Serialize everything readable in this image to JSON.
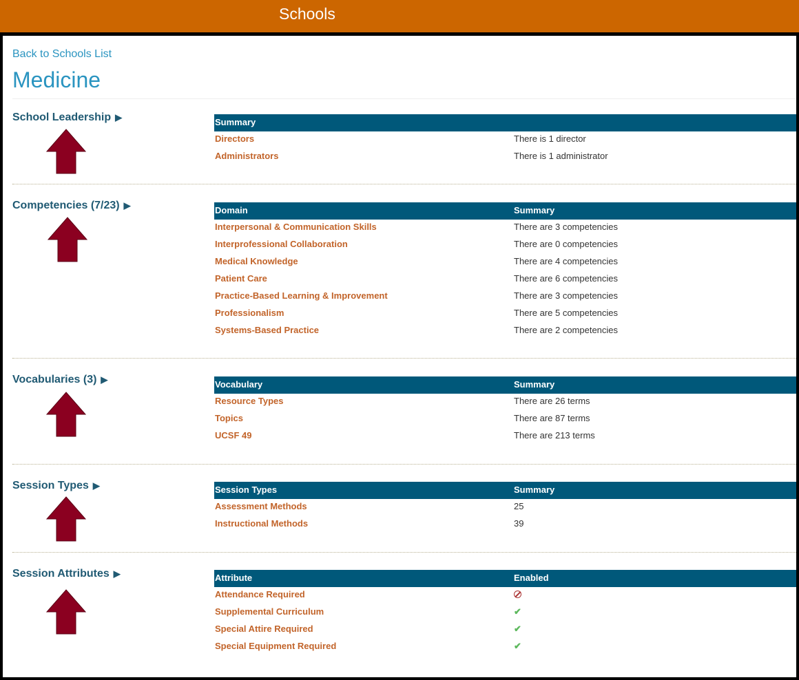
{
  "header": {
    "title": "Schools"
  },
  "back_link": "Back to Schools List",
  "school_name": "Medicine",
  "sections": {
    "leadership": {
      "title": "School Leadership",
      "col1": "Summary",
      "rows": [
        {
          "label": "Directors",
          "value": "There is 1 director"
        },
        {
          "label": "Administrators",
          "value": "There is 1 administrator"
        }
      ]
    },
    "competencies": {
      "title": "Competencies (7/23)",
      "col1": "Domain",
      "col2": "Summary",
      "rows": [
        {
          "label": "Interpersonal & Communication Skills",
          "value": "There are 3 competencies"
        },
        {
          "label": "Interprofessional Collaboration",
          "value": "There are 0 competencies"
        },
        {
          "label": "Medical Knowledge",
          "value": "There are 4 competencies"
        },
        {
          "label": "Patient Care",
          "value": "There are 6 competencies"
        },
        {
          "label": "Practice-Based Learning & Improvement",
          "value": "There are 3 competencies"
        },
        {
          "label": "Professionalism",
          "value": "There are 5 competencies"
        },
        {
          "label": "Systems-Based Practice",
          "value": "There are 2 competencies"
        }
      ]
    },
    "vocabularies": {
      "title": "Vocabularies (3)",
      "col1": "Vocabulary",
      "col2": "Summary",
      "rows": [
        {
          "label": "Resource Types",
          "value": "There are 26 terms"
        },
        {
          "label": "Topics",
          "value": "There are 87 terms"
        },
        {
          "label": "UCSF 49",
          "value": "There are 213 terms"
        }
      ]
    },
    "session_types": {
      "title": "Session Types",
      "col1": "Session Types",
      "col2": "Summary",
      "rows": [
        {
          "label": "Assessment Methods",
          "value": "25"
        },
        {
          "label": "Instructional Methods",
          "value": "39"
        }
      ]
    },
    "session_attributes": {
      "title": "Session Attributes",
      "col1": "Attribute",
      "col2": "Enabled",
      "rows": [
        {
          "label": "Attendance Required",
          "enabled": "no"
        },
        {
          "label": "Supplemental Curriculum",
          "enabled": "yes"
        },
        {
          "label": "Special Attire Required",
          "enabled": "yes"
        },
        {
          "label": "Special Equipment Required",
          "enabled": "yes"
        }
      ]
    }
  },
  "colors": {
    "accent": "#cc6600",
    "table_header": "#00587a",
    "link": "#2a94c0",
    "row_label": "#c2642a",
    "arrow": "#8b0020"
  }
}
